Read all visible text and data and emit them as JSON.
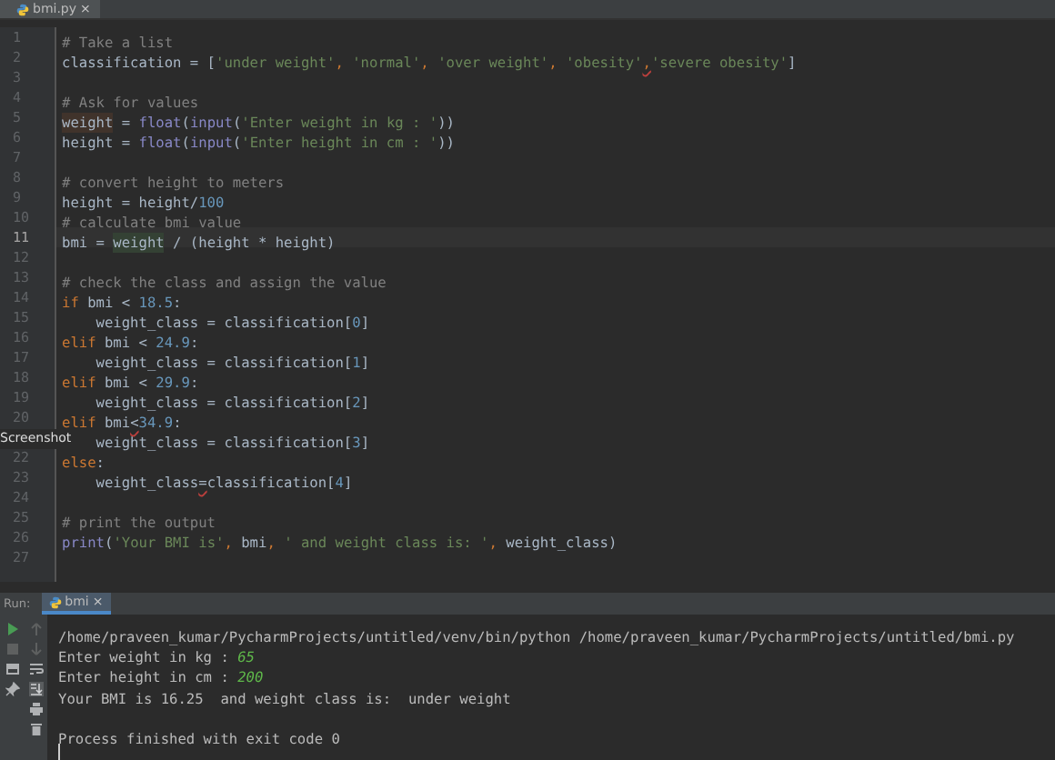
{
  "editor_tab": {
    "label": "bmi.py",
    "close": "×",
    "selected": true
  },
  "code_lines": [
    {
      "number": "1",
      "tokens": [
        {
          "kind": "comment",
          "text": "# Take a list"
        }
      ]
    },
    {
      "number": "2",
      "tokens": [
        {
          "kind": "plain",
          "text": "classification = ["
        },
        {
          "kind": "string",
          "text": "'under weight'"
        },
        {
          "kind": "keyword",
          "text": ", "
        },
        {
          "kind": "string",
          "text": "'normal'"
        },
        {
          "kind": "keyword",
          "text": ", "
        },
        {
          "kind": "string",
          "text": "'over weight'"
        },
        {
          "kind": "keyword",
          "text": ", "
        },
        {
          "kind": "string",
          "text": "'obesity'"
        },
        {
          "kind": "keyword",
          "text": ",",
          "warning": true
        },
        {
          "kind": "string",
          "text": "'severe obesity'"
        },
        {
          "kind": "plain",
          "text": "]"
        }
      ]
    },
    {
      "number": "3"
    },
    {
      "number": "4",
      "tokens": [
        {
          "kind": "comment",
          "text": "# Ask for values"
        }
      ]
    },
    {
      "number": "5",
      "tokens": [
        {
          "kind": "plain",
          "text": "weight",
          "write_usage": true
        },
        {
          "kind": "plain",
          "text": " = "
        },
        {
          "kind": "builtin",
          "text": "float"
        },
        {
          "kind": "plain",
          "text": "("
        },
        {
          "kind": "builtin",
          "text": "input"
        },
        {
          "kind": "plain",
          "text": "("
        },
        {
          "kind": "string",
          "text": "'Enter weight in kg : '"
        },
        {
          "kind": "plain",
          "text": "))"
        }
      ]
    },
    {
      "number": "6",
      "tokens": [
        {
          "kind": "plain",
          "text": "height = "
        },
        {
          "kind": "builtin",
          "text": "float"
        },
        {
          "kind": "plain",
          "text": "("
        },
        {
          "kind": "builtin",
          "text": "input"
        },
        {
          "kind": "plain",
          "text": "("
        },
        {
          "kind": "string",
          "text": "'Enter height in cm : '"
        },
        {
          "kind": "plain",
          "text": "))"
        }
      ]
    },
    {
      "number": "7"
    },
    {
      "number": "8",
      "tokens": [
        {
          "kind": "comment",
          "text": "# convert height to meters"
        }
      ]
    },
    {
      "number": "9",
      "tokens": [
        {
          "kind": "plain",
          "text": "height = height/"
        },
        {
          "kind": "number",
          "text": "100"
        }
      ]
    },
    {
      "number": "10",
      "tokens": [
        {
          "kind": "comment",
          "text": "# calculate bmi value"
        }
      ]
    },
    {
      "number": "11",
      "current": true,
      "tokens": [
        {
          "kind": "plain",
          "text": "bmi = "
        },
        {
          "kind": "plain",
          "text": "weight",
          "read_usage": true
        },
        {
          "kind": "plain",
          "text": " / (height * height)"
        }
      ]
    },
    {
      "number": "12"
    },
    {
      "number": "13",
      "tokens": [
        {
          "kind": "comment",
          "text": "# check the class and assign the value"
        }
      ]
    },
    {
      "number": "14",
      "tokens": [
        {
          "kind": "keyword",
          "text": "if "
        },
        {
          "kind": "plain",
          "text": "bmi < "
        },
        {
          "kind": "number",
          "text": "18.5"
        },
        {
          "kind": "plain",
          "text": ":"
        }
      ]
    },
    {
      "number": "15",
      "tokens": [
        {
          "kind": "plain",
          "text": "    weight_class = classification["
        },
        {
          "kind": "number",
          "text": "0"
        },
        {
          "kind": "plain",
          "text": "]"
        }
      ]
    },
    {
      "number": "16",
      "tokens": [
        {
          "kind": "keyword",
          "text": "elif "
        },
        {
          "kind": "plain",
          "text": "bmi < "
        },
        {
          "kind": "number",
          "text": "24.9"
        },
        {
          "kind": "plain",
          "text": ":"
        }
      ]
    },
    {
      "number": "17",
      "tokens": [
        {
          "kind": "plain",
          "text": "    weight_class = classification["
        },
        {
          "kind": "number",
          "text": "1"
        },
        {
          "kind": "plain",
          "text": "]"
        }
      ]
    },
    {
      "number": "18",
      "tokens": [
        {
          "kind": "keyword",
          "text": "elif "
        },
        {
          "kind": "plain",
          "text": "bmi < "
        },
        {
          "kind": "number",
          "text": "29.9"
        },
        {
          "kind": "plain",
          "text": ":"
        }
      ]
    },
    {
      "number": "19",
      "tokens": [
        {
          "kind": "plain",
          "text": "    weight_class = classification["
        },
        {
          "kind": "number",
          "text": "2"
        },
        {
          "kind": "plain",
          "text": "]"
        }
      ]
    },
    {
      "number": "20",
      "tokens": [
        {
          "kind": "keyword",
          "text": "elif "
        },
        {
          "kind": "plain",
          "text": "bmi"
        },
        {
          "kind": "plain",
          "text": "<",
          "warning": true
        },
        {
          "kind": "number",
          "text": "34.9"
        },
        {
          "kind": "plain",
          "text": ":"
        }
      ]
    },
    {
      "tokens": [
        {
          "kind": "plain",
          "text": "    weight_class = classification["
        },
        {
          "kind": "number",
          "text": "3"
        },
        {
          "kind": "plain",
          "text": "]"
        }
      ]
    },
    {
      "number": "22",
      "tokens": [
        {
          "kind": "keyword",
          "text": "else"
        },
        {
          "kind": "plain",
          "text": ":"
        }
      ]
    },
    {
      "number": "23",
      "tokens": [
        {
          "kind": "plain",
          "text": "    weight_class"
        },
        {
          "kind": "plain",
          "text": "=",
          "warning": true
        },
        {
          "kind": "plain",
          "text": "classification["
        },
        {
          "kind": "number",
          "text": "4"
        },
        {
          "kind": "plain",
          "text": "]"
        }
      ]
    },
    {
      "number": "24"
    },
    {
      "number": "25",
      "tokens": [
        {
          "kind": "comment",
          "text": "# print the output"
        }
      ]
    },
    {
      "number": "26",
      "tokens": [
        {
          "kind": "builtin",
          "text": "print"
        },
        {
          "kind": "plain",
          "text": "("
        },
        {
          "kind": "string",
          "text": "'Your BMI is'"
        },
        {
          "kind": "keyword",
          "text": ", "
        },
        {
          "kind": "plain",
          "text": "bmi"
        },
        {
          "kind": "keyword",
          "text": ", "
        },
        {
          "kind": "string",
          "text": "' and weight class is: '"
        },
        {
          "kind": "keyword",
          "text": ", "
        },
        {
          "kind": "plain",
          "text": "weight_class)"
        }
      ]
    },
    {
      "number": "27"
    }
  ],
  "screenshot_label": "Screenshot",
  "run_panel": {
    "title": "Run:",
    "tab": {
      "label": "bmi",
      "close": "×",
      "selected": true
    },
    "console_lines": [
      {
        "tokens": [
          {
            "kind": "output",
            "text": "/home/praveen_kumar/PycharmProjects/untitled/venv/bin/python /home/praveen_kumar/PycharmProjects/untitled/bmi.py"
          }
        ]
      },
      {
        "tokens": [
          {
            "kind": "output",
            "text": "Enter weight in kg : "
          },
          {
            "kind": "input",
            "text": "65"
          }
        ]
      },
      {
        "tokens": [
          {
            "kind": "output",
            "text": "Enter height in cm : "
          },
          {
            "kind": "input",
            "text": "200"
          }
        ]
      },
      {
        "tokens": [
          {
            "kind": "output",
            "text": "Your BMI is 16.25  and weight class is:  under weight"
          }
        ]
      },
      {
        "gap_before": true,
        "tokens": [
          {
            "kind": "output",
            "text": "Process finished with exit code 0"
          }
        ]
      }
    ]
  }
}
